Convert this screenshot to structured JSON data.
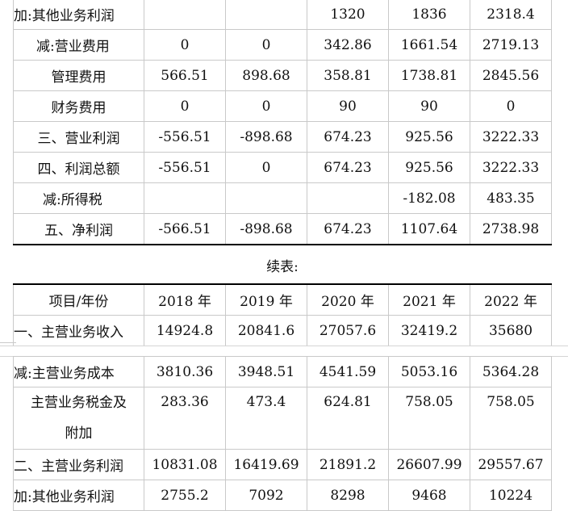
{
  "top_rows": [
    {
      "label": "加:其他业务利润",
      "values": [
        "",
        "",
        "1320",
        "1836",
        "2318.4"
      ]
    },
    {
      "label": "减:营业费用",
      "values": [
        "0",
        "0",
        "342.86",
        "1661.54",
        "2719.13"
      ]
    },
    {
      "label": "管理费用",
      "values": [
        "566.51",
        "898.68",
        "358.81",
        "1738.81",
        "2845.56"
      ]
    },
    {
      "label": "财务费用",
      "values": [
        "0",
        "0",
        "90",
        "90",
        "0"
      ]
    },
    {
      "label": "三、营业利润",
      "values": [
        "-556.51",
        "-898.68",
        "674.23",
        "925.56",
        "3222.33"
      ]
    },
    {
      "label": "四、利润总额",
      "values": [
        "-556.51",
        "0",
        "674.23",
        "925.56",
        "3222.33"
      ]
    },
    {
      "label": "减:所得税",
      "values": [
        "",
        "",
        "",
        "-182.08",
        "483.35"
      ]
    },
    {
      "label": "五、净利润",
      "values": [
        "-566.51",
        "-898.68",
        "674.23",
        "1107.64",
        "2738.98"
      ]
    }
  ],
  "continued_caption": "续表:",
  "header": {
    "label": "项目/年份",
    "years": [
      "2018 年",
      "2019 年",
      "2020 年",
      "2021 年",
      "2022 年"
    ]
  },
  "revenue_row": {
    "label": "一、主营业务收入",
    "values": [
      "14924.8",
      "20841.6",
      "27057.6",
      "32419.2",
      "35680"
    ]
  },
  "bottom_rows": [
    {
      "label": "减:主营业务成本",
      "values": [
        "3810.36",
        "3948.51",
        "4541.59",
        "5053.16",
        "5364.28"
      ]
    },
    {
      "label": "主营业务税金及附加",
      "values": [
        "283.36",
        "473.4",
        "624.81",
        "758.05",
        "758.05"
      ]
    },
    {
      "label": "二、主营业务利润",
      "values": [
        "10831.08",
        "16419.69",
        "21891.2",
        "26607.99",
        "29557.67"
      ]
    },
    {
      "label": "加:其他业务利润",
      "values": [
        "2755.2",
        "7092",
        "8298",
        "9468",
        "10224"
      ]
    }
  ]
}
